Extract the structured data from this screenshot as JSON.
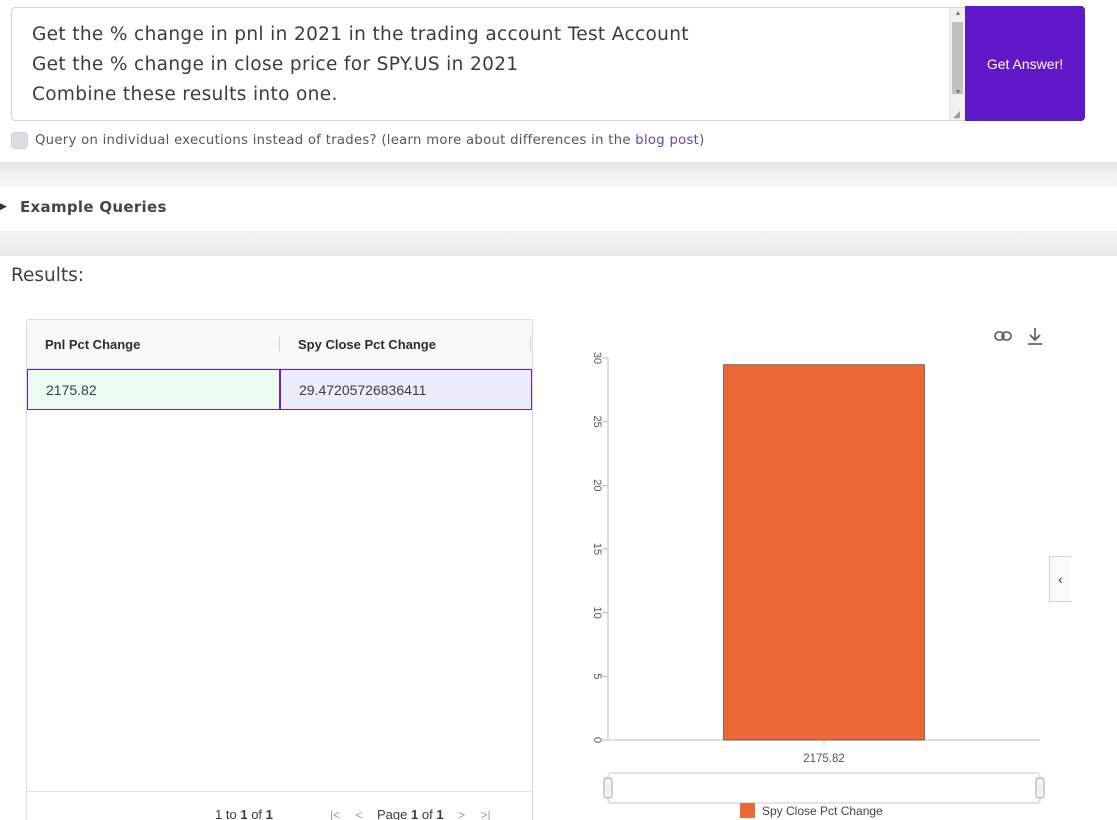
{
  "query": {
    "lines": [
      "Get the % change in pnl in 2021 in the trading account Test Account",
      "Get the % change in close price for SPY.US in 2021",
      "Combine these results into one."
    ],
    "submit_label": "Get Answer!"
  },
  "executions_option": {
    "label_before": "Query on individual executions instead of trades? (learn more about differences in the ",
    "link_text": "blog post",
    "label_after": ")",
    "checked": false
  },
  "examples": {
    "label": "Example Queries"
  },
  "results": {
    "title": "Results:",
    "columns": [
      "Pnl Pct Change",
      "Spy Close Pct Change"
    ],
    "rows": [
      [
        "2175.82",
        "29.47205726836411"
      ]
    ],
    "pager": {
      "range_from": "1",
      "range_word_to": "to",
      "range_to": "1",
      "of_word": "of",
      "total": "1",
      "page_word": "Page",
      "page": "1",
      "page_total": "1",
      "first_icon": "first-page-icon",
      "prev_icon": "prev-page-icon",
      "next_icon": "next-page-icon",
      "last_icon": "last-page-icon"
    }
  },
  "chart_data": {
    "type": "bar",
    "categories": [
      "2175.82"
    ],
    "series": [
      {
        "name": "Spy Close Pct Change",
        "values": [
          29.47
        ],
        "color": "#ec6836"
      }
    ],
    "ylim": [
      0,
      30
    ],
    "yticks": [
      "0",
      "5",
      "10",
      "15",
      "20",
      "25",
      "30"
    ],
    "legend": "bottom",
    "grid": false
  },
  "chart_tools": {
    "link_icon": "link-icon",
    "download_icon": "download-icon",
    "toggle_icon": "chevron-left-icon"
  },
  "colors": {
    "accent": "#6118c8",
    "bar": "#ec6836",
    "link": "#6b3fb8"
  }
}
